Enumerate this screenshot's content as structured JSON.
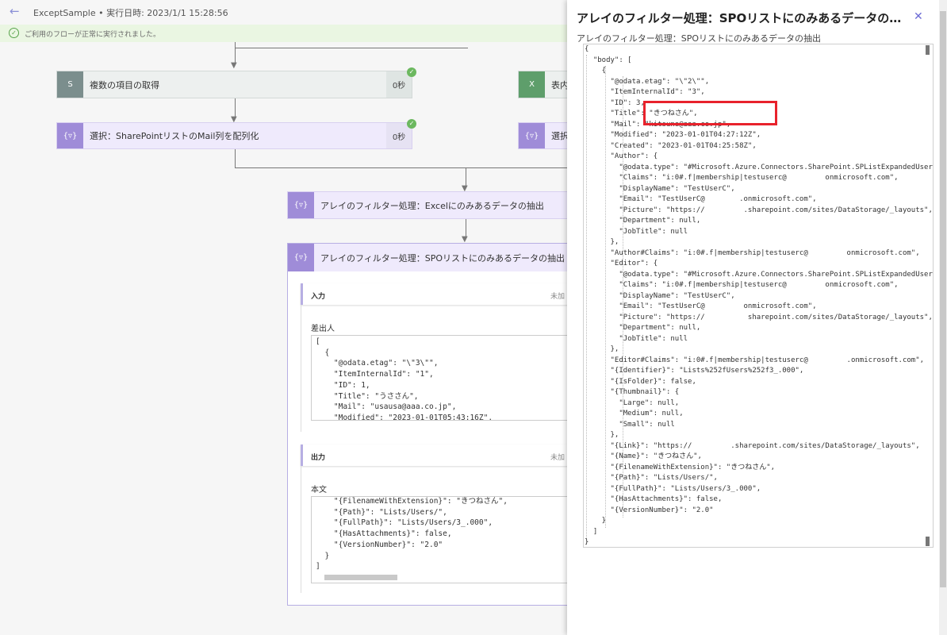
{
  "header": {
    "back_icon": "back-arrow-icon",
    "title": "ExceptSample • 実行日時: 2023/1/1 15:28:56",
    "banner": "ご利用のフローが正常に実行されました。"
  },
  "flow": {
    "step1": {
      "label": "複数の項目の取得",
      "duration": "0秒",
      "icon": "sharepoint-icon",
      "icon_label": "S"
    },
    "step2": {
      "label": "選択：SharePointリストのMail列を配列化",
      "duration": "0秒",
      "icon": "select-icon",
      "icon_label": "{▿}"
    },
    "step3": {
      "label": "表内",
      "icon": "excel-icon",
      "icon_label": "X"
    },
    "step4": {
      "label": "選択",
      "icon": "select-icon",
      "icon_label": "{▿}"
    },
    "step5": {
      "label": "アレイのフィルター処理：Excelにのみあるデータの抽出",
      "icon": "filter-icon",
      "icon_label": "{▿}"
    },
    "step6": {
      "label": "アレイのフィルター処理：SPOリストにのみあるデータの抽出",
      "icon": "filter-icon",
      "icon_label": "{▿}",
      "input_title": "入力",
      "input_right": "未加",
      "input_field": "差出人",
      "input_code": "[\n  {\n    \"@odata.etag\": \"\\\"3\\\"\",\n    \"ItemInternalId\": \"1\",\n    \"ID\": 1,\n    \"Title\": \"うささん\",\n    \"Mail\": \"usausa@aaa.co.jp\",\n    \"Modified\": \"2023-01-01T05:43:16Z\",",
      "output_title": "出力",
      "output_right": "未加",
      "output_field": "本文",
      "output_code": "    \"{FilenameWithExtension}\": \"きつねさん\",\n    \"{Path}\": \"Lists/Users/\",\n    \"{FullPath}\": \"Lists/Users/3_.000\",\n    \"{HasAttachments}\": false,\n    \"{VersionNumber}\": \"2.0\"\n  }\n]"
    }
  },
  "panel": {
    "title": "アレイのフィルター処理：SPOリストにのみあるデータの抽出",
    "subtitle": "アレイのフィルター処理：SPOリストにのみあるデータの抽出",
    "close_icon": "close-icon",
    "code": "{\n  \"body\": [\n    {\n      \"@odata.etag\": \"\\\"2\\\"\",\n      \"ItemInternalId\": \"3\",\n      \"ID\": 3,\n      \"Title\": \"きつねさん\",\n      \"Mail\": \"kitsune@aaa.co.jp\",\n      \"Modified\": \"2023-01-01T04:27:12Z\",\n      \"Created\": \"2023-01-01T04:25:58Z\",\n      \"Author\": {\n        \"@odata.type\": \"#Microsoft.Azure.Connectors.SharePoint.SPListExpandedUser\",\n        \"Claims\": \"i:0#.f|membership|testuserc@         onmicrosoft.com\",\n        \"DisplayName\": \"TestUserC\",\n        \"Email\": \"TestUserC@        .onmicrosoft.com\",\n        \"Picture\": \"https://         .sharepoint.com/sites/DataStorage/_layouts\",\n        \"Department\": null,\n        \"JobTitle\": null\n      },\n      \"Author#Claims\": \"i:0#.f|membership|testuserc@         onmicrosoft.com\",\n      \"Editor\": {\n        \"@odata.type\": \"#Microsoft.Azure.Connectors.SharePoint.SPListExpandedUser\",\n        \"Claims\": \"i:0#.f|membership|testuserc@         onmicrosoft.com\",\n        \"DisplayName\": \"TestUserC\",\n        \"Email\": \"TestUserC@         onmicrosoft.com\",\n        \"Picture\": \"https://          sharepoint.com/sites/DataStorage/_layouts\",\n        \"Department\": null,\n        \"JobTitle\": null\n      },\n      \"Editor#Claims\": \"i:0#.f|membership|testuserc@         .onmicrosoft.com\",\n      \"{Identifier}\": \"Lists%252fUsers%252f3_.000\",\n      \"{IsFolder}\": false,\n      \"{Thumbnail}\": {\n        \"Large\": null,\n        \"Medium\": null,\n        \"Small\": null\n      },\n      \"{Link}\": \"https://         .sharepoint.com/sites/DataStorage/_layouts\",\n      \"{Name}\": \"きつねさん\",\n      \"{FilenameWithExtension}\": \"きつねさん\",\n      \"{Path}\": \"Lists/Users/\",\n      \"{FullPath}\": \"Lists/Users/3_.000\",\n      \"{HasAttachments}\": false,\n      \"{VersionNumber}\": \"2.0\"\n    }\n  ]\n}"
  },
  "colors": {
    "accent": "#6b6ad4",
    "highlight": "#e8222c",
    "success": "#6cb85f",
    "select_icon": "#9f8cd8",
    "excel": "#5e9e6b"
  }
}
